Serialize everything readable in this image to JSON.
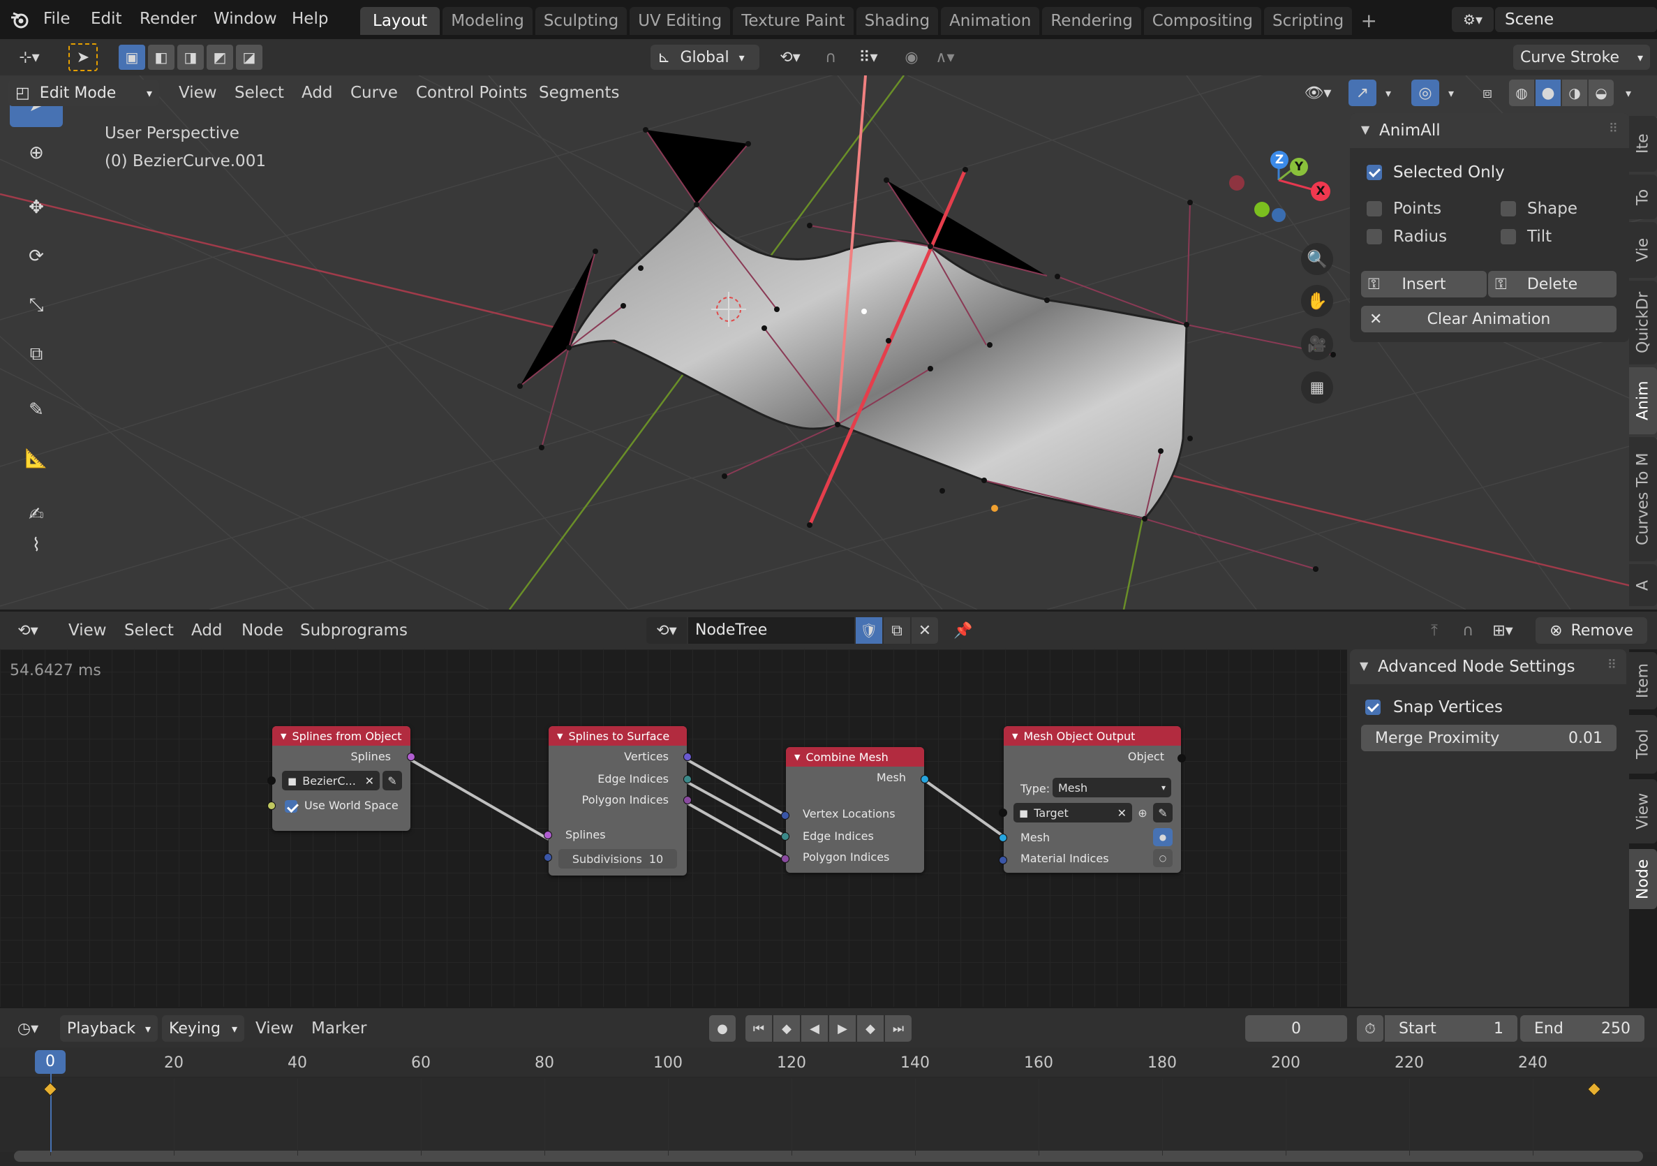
{
  "menubar": {
    "items": [
      "File",
      "Edit",
      "Render",
      "Window",
      "Help"
    ]
  },
  "workspace_tabs": [
    {
      "label": "Layout",
      "active": true
    },
    {
      "label": "Modeling"
    },
    {
      "label": "Sculpting"
    },
    {
      "label": "UV Editing"
    },
    {
      "label": "Texture Paint"
    },
    {
      "label": "Shading"
    },
    {
      "label": "Animation"
    },
    {
      "label": "Rendering"
    },
    {
      "label": "Compositing"
    },
    {
      "label": "Scripting"
    }
  ],
  "scene": {
    "name": "Scene"
  },
  "tool_header": {
    "orientation": "Global",
    "brush": "Curve Stroke"
  },
  "viewport_header": {
    "mode": "Edit Mode",
    "menus": [
      "View",
      "Select",
      "Add",
      "Curve",
      "Control Points",
      "Segments"
    ]
  },
  "viewport": {
    "perspective_label": "User Perspective",
    "object_label": "(0) BezierCurve.001",
    "gizmo": {
      "x": "X",
      "y": "Y",
      "z": "Z"
    }
  },
  "animall": {
    "title": "AnimAll",
    "selected_only": "Selected Only",
    "points": "Points",
    "shape": "Shape",
    "radius": "Radius",
    "tilt": "Tilt",
    "insert": "Insert",
    "delete": "Delete",
    "clear": "Clear Animation"
  },
  "viewport_tabs": [
    "Ite",
    "To",
    "Vie",
    "QuickDr",
    "Anim",
    "Curves To M",
    "A"
  ],
  "node_header": {
    "menus": [
      "View",
      "Select",
      "Add",
      "Node",
      "Subprograms"
    ],
    "tree_name": "NodeTree",
    "remove": "Remove"
  },
  "node_editor": {
    "timing": "54.6427 ms",
    "nodes": {
      "splines_from_object": {
        "title": "Splines from Object",
        "out_splines": "Splines",
        "object": "BezierC...",
        "use_world": "Use World Space"
      },
      "splines_to_surface": {
        "title": "Splines to Surface",
        "out_vertices": "Vertices",
        "out_edges": "Edge Indices",
        "out_polygons": "Polygon Indices",
        "in_splines": "Splines",
        "subdiv_label": "Subdivisions",
        "subdiv_value": "10"
      },
      "combine_mesh": {
        "title": "Combine Mesh",
        "out_mesh": "Mesh",
        "in_vertex": "Vertex Locations",
        "in_edge": "Edge Indices",
        "in_poly": "Polygon Indices"
      },
      "mesh_object_output": {
        "title": "Mesh Object Output",
        "out_object": "Object",
        "type_label": "Type:",
        "type_value": "Mesh",
        "target": "Target",
        "in_mesh": "Mesh",
        "in_material": "Material Indices"
      }
    }
  },
  "node_sidebar": {
    "title": "Advanced Node Settings",
    "snap": "Snap Vertices",
    "merge_label": "Merge Proximity",
    "merge_value": "0.01"
  },
  "node_tabs": [
    "Item",
    "Tool",
    "View",
    "Node"
  ],
  "timeline": {
    "menus": [
      "Playback",
      "Keying",
      "View",
      "Marker"
    ],
    "current_frame": "0",
    "start_label": "Start",
    "start": "1",
    "end_label": "End",
    "end": "250",
    "ticks": [
      "0",
      "20",
      "40",
      "60",
      "80",
      "100",
      "120",
      "140",
      "160",
      "180",
      "200",
      "220",
      "240"
    ]
  }
}
